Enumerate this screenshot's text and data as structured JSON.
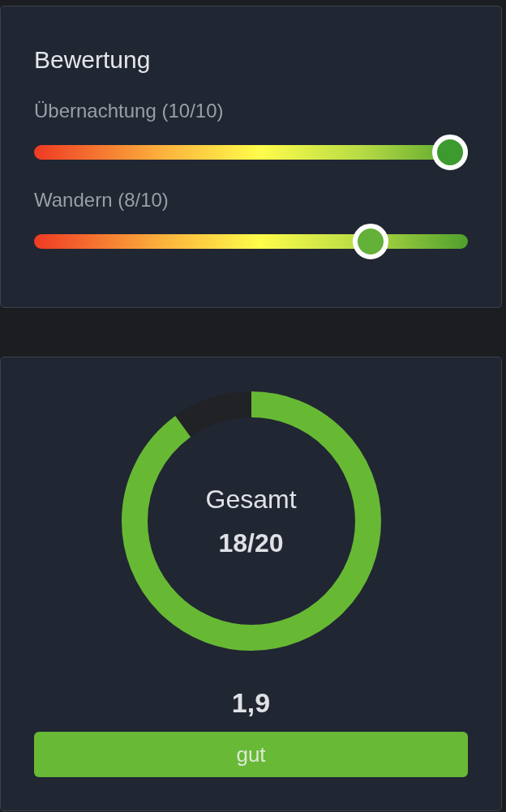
{
  "rating_card": {
    "title": "Bewertung",
    "sliders": [
      {
        "label": "Übernachtung (10/10)",
        "level": 1.0
      },
      {
        "label": "Wandern (8/10)",
        "level": 0.8
      }
    ]
  },
  "total_card": {
    "gauge": {
      "label": "Gesamt",
      "value": "18/20",
      "level": 0.9
    },
    "grade": "1,9",
    "verdict": "gut"
  }
}
